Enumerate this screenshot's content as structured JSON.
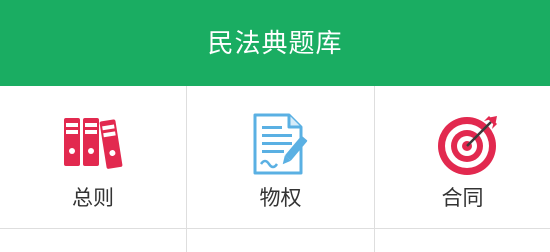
{
  "header": {
    "title": "民法典题库"
  },
  "categories": [
    {
      "label": "总则",
      "icon": "binders-icon"
    },
    {
      "label": "物权",
      "icon": "document-pen-icon"
    },
    {
      "label": "合同",
      "icon": "target-arrow-icon"
    }
  ],
  "colors": {
    "header_bg": "#1aad62",
    "binders": "#e2294f",
    "document": "#5ab0e3",
    "target": "#e2294f"
  }
}
